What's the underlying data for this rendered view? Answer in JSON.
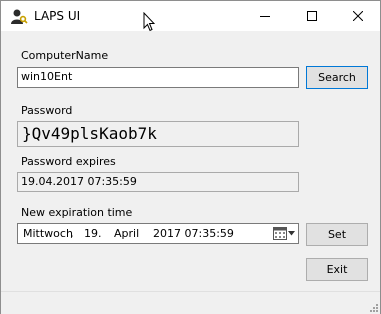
{
  "window": {
    "title": "LAPS UI",
    "app_icon": "user-key-icon",
    "controls": [
      "minimize-icon",
      "maximize-icon",
      "close-icon"
    ]
  },
  "form": {
    "computer_name_label": "ComputerName",
    "computer_name_value": "win10Ent",
    "search_label": "Search",
    "password_label": "Password",
    "password_value": "}Qv49plsKaob7k",
    "password_expires_label": "Password expires",
    "password_expires_value": "19.04.2017 07:35:59",
    "new_expiration_label": "New expiration time",
    "new_expiration": {
      "weekday": "Mittwoch",
      "separator": ",",
      "day": "19.",
      "month": "April",
      "year_time": "2017 07:35:59"
    },
    "set_label": "Set",
    "exit_label": "Exit"
  },
  "colors": {
    "accent": "#0078d7",
    "window_bg": "#f0f0f0",
    "button_bg": "#e1e1e1"
  }
}
